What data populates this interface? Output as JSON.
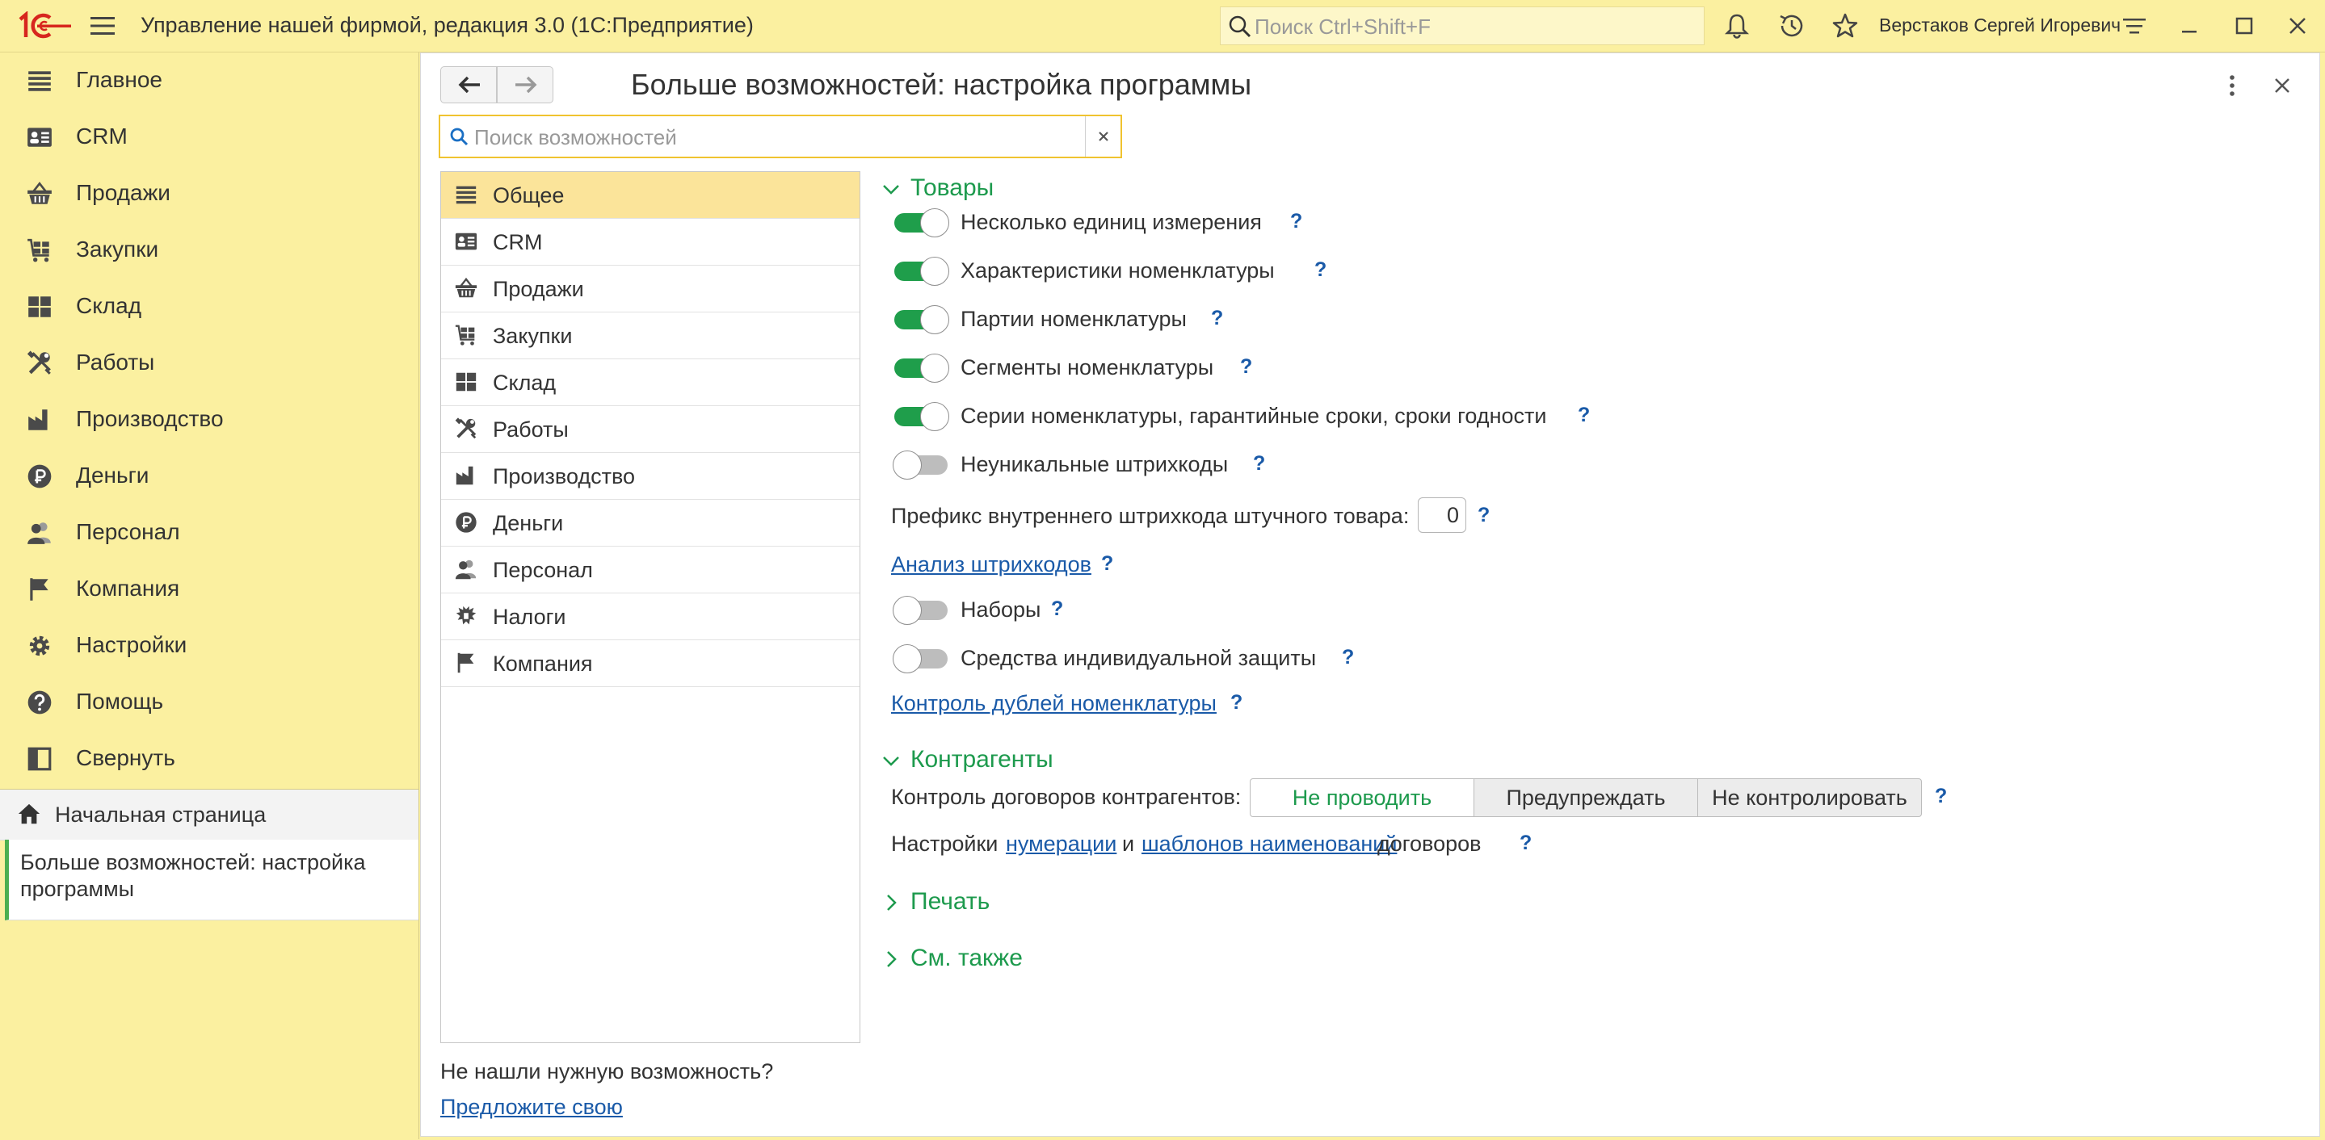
{
  "titlebar": {
    "app_title": "Управление нашей фирмой, редакция 3.0  (1С:Предприятие)",
    "search_placeholder": "Поиск Ctrl+Shift+F",
    "user_name": "Верстаков Сергей Игоревич",
    "icons": [
      "bell-icon",
      "history-icon",
      "star-icon",
      "settings-lines-icon",
      "minimize-icon",
      "maximize-icon",
      "window-close-icon"
    ]
  },
  "sidebar": {
    "items": [
      {
        "label": "Главное",
        "icon": "main-menu-icon"
      },
      {
        "label": "CRM",
        "icon": "crm-icon"
      },
      {
        "label": "Продажи",
        "icon": "sales-basket-icon"
      },
      {
        "label": "Закупки",
        "icon": "purchases-cart-icon"
      },
      {
        "label": "Склад",
        "icon": "warehouse-icon"
      },
      {
        "label": "Работы",
        "icon": "tools-icon"
      },
      {
        "label": "Производство",
        "icon": "factory-icon"
      },
      {
        "label": "Деньги",
        "icon": "ruble-icon"
      },
      {
        "label": "Персонал",
        "icon": "people-icon"
      },
      {
        "label": "Компания",
        "icon": "flag-icon"
      },
      {
        "label": "Настройки",
        "icon": "gear-icon"
      },
      {
        "label": "Помощь",
        "icon": "help-circle-icon"
      },
      {
        "label": "Свернуть",
        "icon": "collapse-panel-icon"
      }
    ],
    "home_label": "Начальная страница",
    "active_window_label": "Больше возможностей: настройка программы"
  },
  "main": {
    "title": "Больше возможностей: настройка программы",
    "search_placeholder": "Поиск возможностей",
    "categories": [
      {
        "label": "Общее",
        "icon": "main-menu-icon",
        "selected": true
      },
      {
        "label": "CRM",
        "icon": "crm-icon"
      },
      {
        "label": "Продажи",
        "icon": "sales-basket-icon"
      },
      {
        "label": "Закупки",
        "icon": "purchases-cart-icon"
      },
      {
        "label": "Склад",
        "icon": "warehouse-icon"
      },
      {
        "label": "Работы",
        "icon": "tools-icon"
      },
      {
        "label": "Производство",
        "icon": "factory-icon"
      },
      {
        "label": "Деньги",
        "icon": "ruble-icon"
      },
      {
        "label": "Персонал",
        "icon": "people-icon"
      },
      {
        "label": "Налоги",
        "icon": "emblem-icon"
      },
      {
        "label": "Компания",
        "icon": "flag-icon"
      }
    ],
    "not_found_text": "Не нашли нужную возможность?",
    "suggest_link": "Предложите свою",
    "goods": {
      "title": "Товары",
      "toggles": [
        {
          "label": "Несколько единиц измерения",
          "on": true
        },
        {
          "label": "Характеристики номенклатуры",
          "on": true
        },
        {
          "label": "Партии номенклатуры",
          "on": true
        },
        {
          "label": "Сегменты номенклатуры",
          "on": true
        },
        {
          "label": "Серии номенклатуры, гарантийные сроки, сроки годности",
          "on": true
        },
        {
          "label": "Неуникальные штрихкоды",
          "on": false
        }
      ],
      "prefix_label": "Префикс внутреннего штрихкода штучного товара:",
      "prefix_value": "0",
      "barcode_analysis_link": "Анализ штрихкодов",
      "toggles2": [
        {
          "label": "Наборы",
          "on": false
        },
        {
          "label": "Средства индивидуальной защиты",
          "on": false
        }
      ],
      "duplicates_link": "Контроль дублей номенклатуры"
    },
    "counterparties": {
      "title": "Контрагенты",
      "contract_label": "Контроль договоров контрагентов:",
      "options": [
        "Не проводить",
        "Предупреждать",
        "Не контролировать"
      ],
      "selected": "Не проводить",
      "settings_prefix": "Настройки",
      "numbering_link": "нумерации",
      "and_text": "и",
      "templates_link": "шаблонов наименований",
      "contracts_text": "договоров"
    },
    "print_title": "Печать",
    "see_also_title": "См. также",
    "help_mark": "?"
  },
  "colors": {
    "sidebar_bg": "#fbf0a0",
    "selected_category_bg": "#fbe49a",
    "accent_green": "#1d9a4d",
    "toggle_on": "#1f9e4b",
    "toggle_off": "#bdbdbd",
    "link_blue": "#1a5aa8",
    "search_border": "#f0c330",
    "logo_red": "#d7261e"
  }
}
